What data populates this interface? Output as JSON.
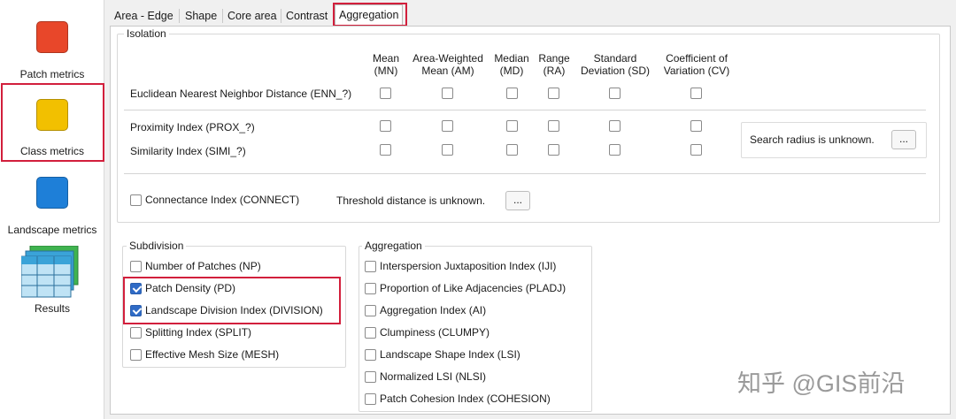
{
  "sidebar": {
    "items": [
      {
        "label": "Patch metrics",
        "color": "#e8472a"
      },
      {
        "label": "Class metrics",
        "color": "#f2c000"
      },
      {
        "label": "Landscape metrics",
        "color": "#1e7fd8"
      },
      {
        "label": "Results"
      }
    ]
  },
  "tabs": [
    "Area - Edge",
    "Shape",
    "Core area",
    "Contrast",
    "Aggregation"
  ],
  "isolation": {
    "title": "Isolation",
    "columns": [
      {
        "line1": "Mean",
        "line2": "(MN)"
      },
      {
        "line1": "Area-Weighted",
        "line2": "Mean (AM)"
      },
      {
        "line1": "Median",
        "line2": "(MD)"
      },
      {
        "line1": "Range",
        "line2": "(RA)"
      },
      {
        "line1": "Standard",
        "line2": "Deviation (SD)"
      },
      {
        "line1": "Coefficient of",
        "line2": "Variation (CV)"
      }
    ],
    "rows": [
      "Euclidean Nearest Neighbor Distance  (ENN_?)",
      "Proximity Index  (PROX_?)",
      "Similarity Index  (SIMI_?)"
    ],
    "search_radius_text": "Search radius is unknown.",
    "browse_label": "...",
    "connectance_label": "Connectance Index  (CONNECT)",
    "threshold_text": "Threshold distance is unknown.",
    "threshold_browse": "..."
  },
  "subdivision": {
    "title": "Subdivision",
    "items": [
      {
        "label": "Number of Patches  (NP)",
        "checked": false
      },
      {
        "label": "Patch Density  (PD)",
        "checked": true
      },
      {
        "label": "Landscape Division Index  (DIVISION)",
        "checked": true
      },
      {
        "label": "Splitting Index  (SPLIT)",
        "checked": false
      },
      {
        "label": "Effective Mesh Size  (MESH)",
        "checked": false
      }
    ]
  },
  "aggregation": {
    "title": "Aggregation",
    "items": [
      {
        "label": "Interspersion  Juxtaposition Index (IJI)",
        "checked": false
      },
      {
        "label": "Proportion of Like Adjacencies  (PLADJ)",
        "checked": false
      },
      {
        "label": "Aggregation Index (AI)",
        "checked": false
      },
      {
        "label": "Clumpiness (CLUMPY)",
        "checked": false
      },
      {
        "label": "Landscape Shape Index  (LSI)",
        "checked": false
      },
      {
        "label": "Normalized LSI (NLSI)",
        "checked": false
      },
      {
        "label": "Patch Cohesion Index  (COHESION)",
        "checked": false
      }
    ]
  },
  "watermark": "知乎 @GIS前沿",
  "colors": {
    "highlight": "#d21f3c",
    "check": "#2f6bc6"
  }
}
